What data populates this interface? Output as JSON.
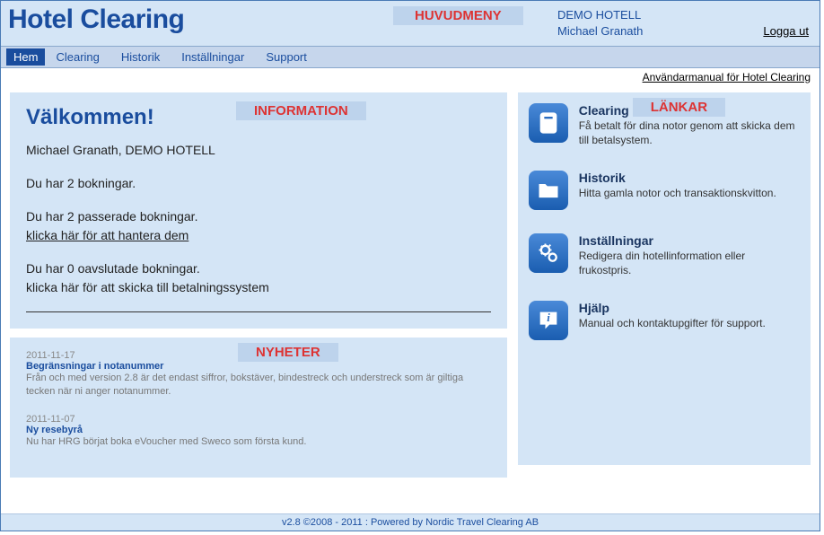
{
  "header": {
    "logo": "Hotel Clearing",
    "huvudmeny_tag": "HUVUDMENY",
    "hotel_name": "DEMO HOTELL",
    "user_name": "Michael Granath",
    "logout": "Logga ut"
  },
  "menu": {
    "items": [
      "Hem",
      "Clearing",
      "Historik",
      "Inställningar",
      "Support"
    ],
    "active_index": 0
  },
  "manual_link": "Användarmanual för Hotel Clearing",
  "info": {
    "tag": "INFORMATION",
    "welcome": "Välkommen!",
    "user_line": "Michael Granath, DEMO HOTELL",
    "bookings_line": "Du har 2 bokningar.",
    "passed_line": "Du har 2 passerade bokningar.",
    "passed_link": "klicka här för att hantera dem",
    "unfinished_line": "Du har 0 oavslutade bokningar.",
    "unfinished_action": "klicka här för att skicka till betalningssystem"
  },
  "news": {
    "tag": "NYHETER",
    "items": [
      {
        "date": "2011-11-17",
        "title": "Begränsningar i notanummer",
        "body": "Från och med version 2.8 är det endast siffror, bokstäver, bindestreck och understreck som är giltiga tecken när ni anger notanummer."
      },
      {
        "date": "2011-11-07",
        "title": "Ny resebyrå",
        "body": "Nu har HRG börjat boka eVoucher med Sweco som första kund."
      }
    ]
  },
  "links": {
    "tag": "LÄNKAR",
    "items": [
      {
        "icon": "calculator",
        "title": "Clearing",
        "desc": "Få betalt för dina notor genom att skicka dem till betalsystem."
      },
      {
        "icon": "folder",
        "title": "Historik",
        "desc": "Hitta gamla notor och transaktionskvitton."
      },
      {
        "icon": "gears",
        "title": "Inställningar",
        "desc": "Redigera din hotellinformation eller frukostpris."
      },
      {
        "icon": "help",
        "title": "Hjälp",
        "desc": "Manual och kontaktupgifter för support."
      }
    ]
  },
  "footer": "v2.8 ©2008 - 2011 : Powered by Nordic Travel Clearing AB"
}
